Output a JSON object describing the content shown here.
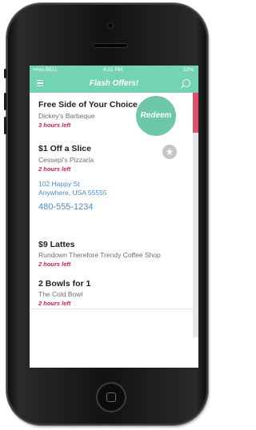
{
  "status_bar": {
    "carrier": "•••oo BELL",
    "time": "4:21 PM",
    "battery": "22%"
  },
  "nav": {
    "title": "Flash Offers!"
  },
  "offers": [
    {
      "title": "Free Side of Your Choice",
      "merchant": "Dickey's Barbeque",
      "time_left": "3 hours left"
    },
    {
      "title": "$1 Off a Slice",
      "merchant": "Cessepi's Pizzaria",
      "time_left": "2 hours left",
      "address_line1": "102 Happy St",
      "address_line2": "Anywhere, USA 55555",
      "phone": "480-555-1234"
    },
    {
      "title": "$9 Lattes",
      "merchant": "Rundown Therefore Trendy Coffee Shop",
      "time_left": "2 hours left"
    },
    {
      "title": "2 Bowls for 1",
      "merchant": "The Cold Bowl",
      "time_left": "2 hours left"
    }
  ],
  "actions": {
    "redeem_label": "Redeem",
    "star_glyph": "★"
  },
  "colors": {
    "accent": "#74d3b2",
    "urgent": "#d0213f",
    "link": "#4a8bd6",
    "scroll_thumb": "#e0506a"
  }
}
